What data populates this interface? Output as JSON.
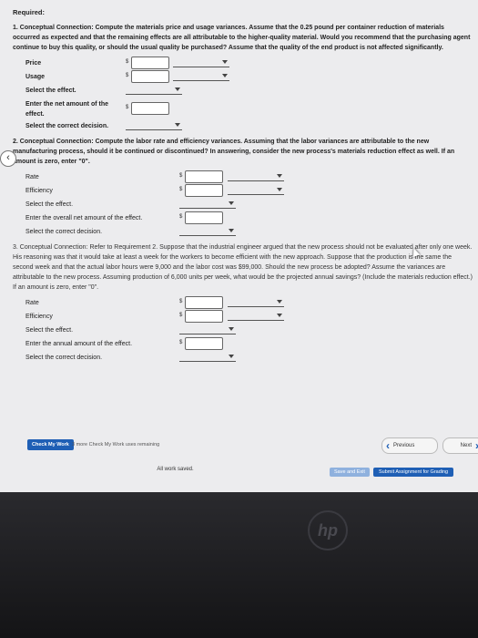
{
  "required_label": "Required:",
  "q1": {
    "text": "1. Conceptual Connection: Compute the materials price and usage variances. Assume that the 0.25 pound per container reduction of materials occurred as expected and that the remaining effects are all attributable to the higher-quality material. Would you recommend that the purchasing agent continue to buy this quality, or should the usual quality be purchased? Assume that the quality of the end product is not affected significantly.",
    "rows": {
      "price": "Price",
      "usage": "Usage",
      "effect": "Select the effect.",
      "net_amount": "Enter the net amount of the effect.",
      "decision": "Select the correct decision."
    },
    "currency": "$"
  },
  "q2": {
    "text": "2. Conceptual Connection: Compute the labor rate and efficiency variances. Assuming that the labor variances are attributable to the new manufacturing process, should it be continued or discontinued? In answering, consider the new process's materials reduction effect as well. If an amount is zero, enter \"0\".",
    "rows": {
      "rate": "Rate",
      "efficiency": "Efficiency",
      "effect": "Select the effect.",
      "overall_net": "Enter the overall net amount of the effect.",
      "decision": "Select the correct decision."
    },
    "currency": "$"
  },
  "q3": {
    "text": "3. Conceptual Connection: Refer to Requirement 2. Suppose that the industrial engineer argued that the new process should not be evaluated after only one week. His reasoning was that it would take at least a week for the workers to become efficient with the new approach. Suppose that the production is the same the second week and that the actual labor hours were 9,000 and the labor cost was $99,000. Should the new process be adopted? Assume the variances are attributable to the new process. Assuming production of 6,000 units per week, what would be the projected annual savings? (Include the materials reduction effect.) If an amount is zero, enter \"0\".",
    "rows": {
      "rate": "Rate",
      "efficiency": "Efficiency",
      "effect": "Select the effect.",
      "annual_amount": "Enter the annual amount of the effect.",
      "decision": "Select the correct decision."
    },
    "currency": "$"
  },
  "footer": {
    "check_label": "Check My Work",
    "remaining": "3 more Check My Work uses remaining",
    "previous": "Previous",
    "next": "Next",
    "saved": "All work saved.",
    "save_exit": "Save and Exit",
    "submit": "Submit Assignment for Grading"
  },
  "bezel_logo": "hp"
}
